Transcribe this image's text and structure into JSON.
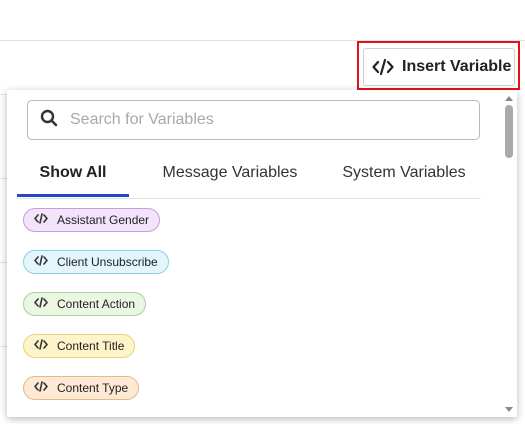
{
  "toolbar": {
    "insert_label": "Insert Variable",
    "highlight_color": "#e0131b"
  },
  "search": {
    "placeholder": "Search for Variables",
    "value": ""
  },
  "tabs": [
    {
      "label": "Show All",
      "active": true
    },
    {
      "label": "Message Variables",
      "active": false
    },
    {
      "label": "System Variables",
      "active": false
    }
  ],
  "variables": [
    {
      "label": "Assistant Gender",
      "bg": "#f3e3fb",
      "border": "#c99ce0"
    },
    {
      "label": "Client Unsubscribe",
      "bg": "#e2f6fb",
      "border": "#8fd0e2"
    },
    {
      "label": "Content Action",
      "bg": "#e9f7e3",
      "border": "#a6d495"
    },
    {
      "label": "Content Title",
      "bg": "#fdf5c9",
      "border": "#e5d577"
    },
    {
      "label": "Content Type",
      "bg": "#fde9d4",
      "border": "#e6b98a"
    }
  ],
  "icons": {
    "code": "code-icon",
    "search": "search-icon"
  },
  "accent_color": "#2847c6"
}
